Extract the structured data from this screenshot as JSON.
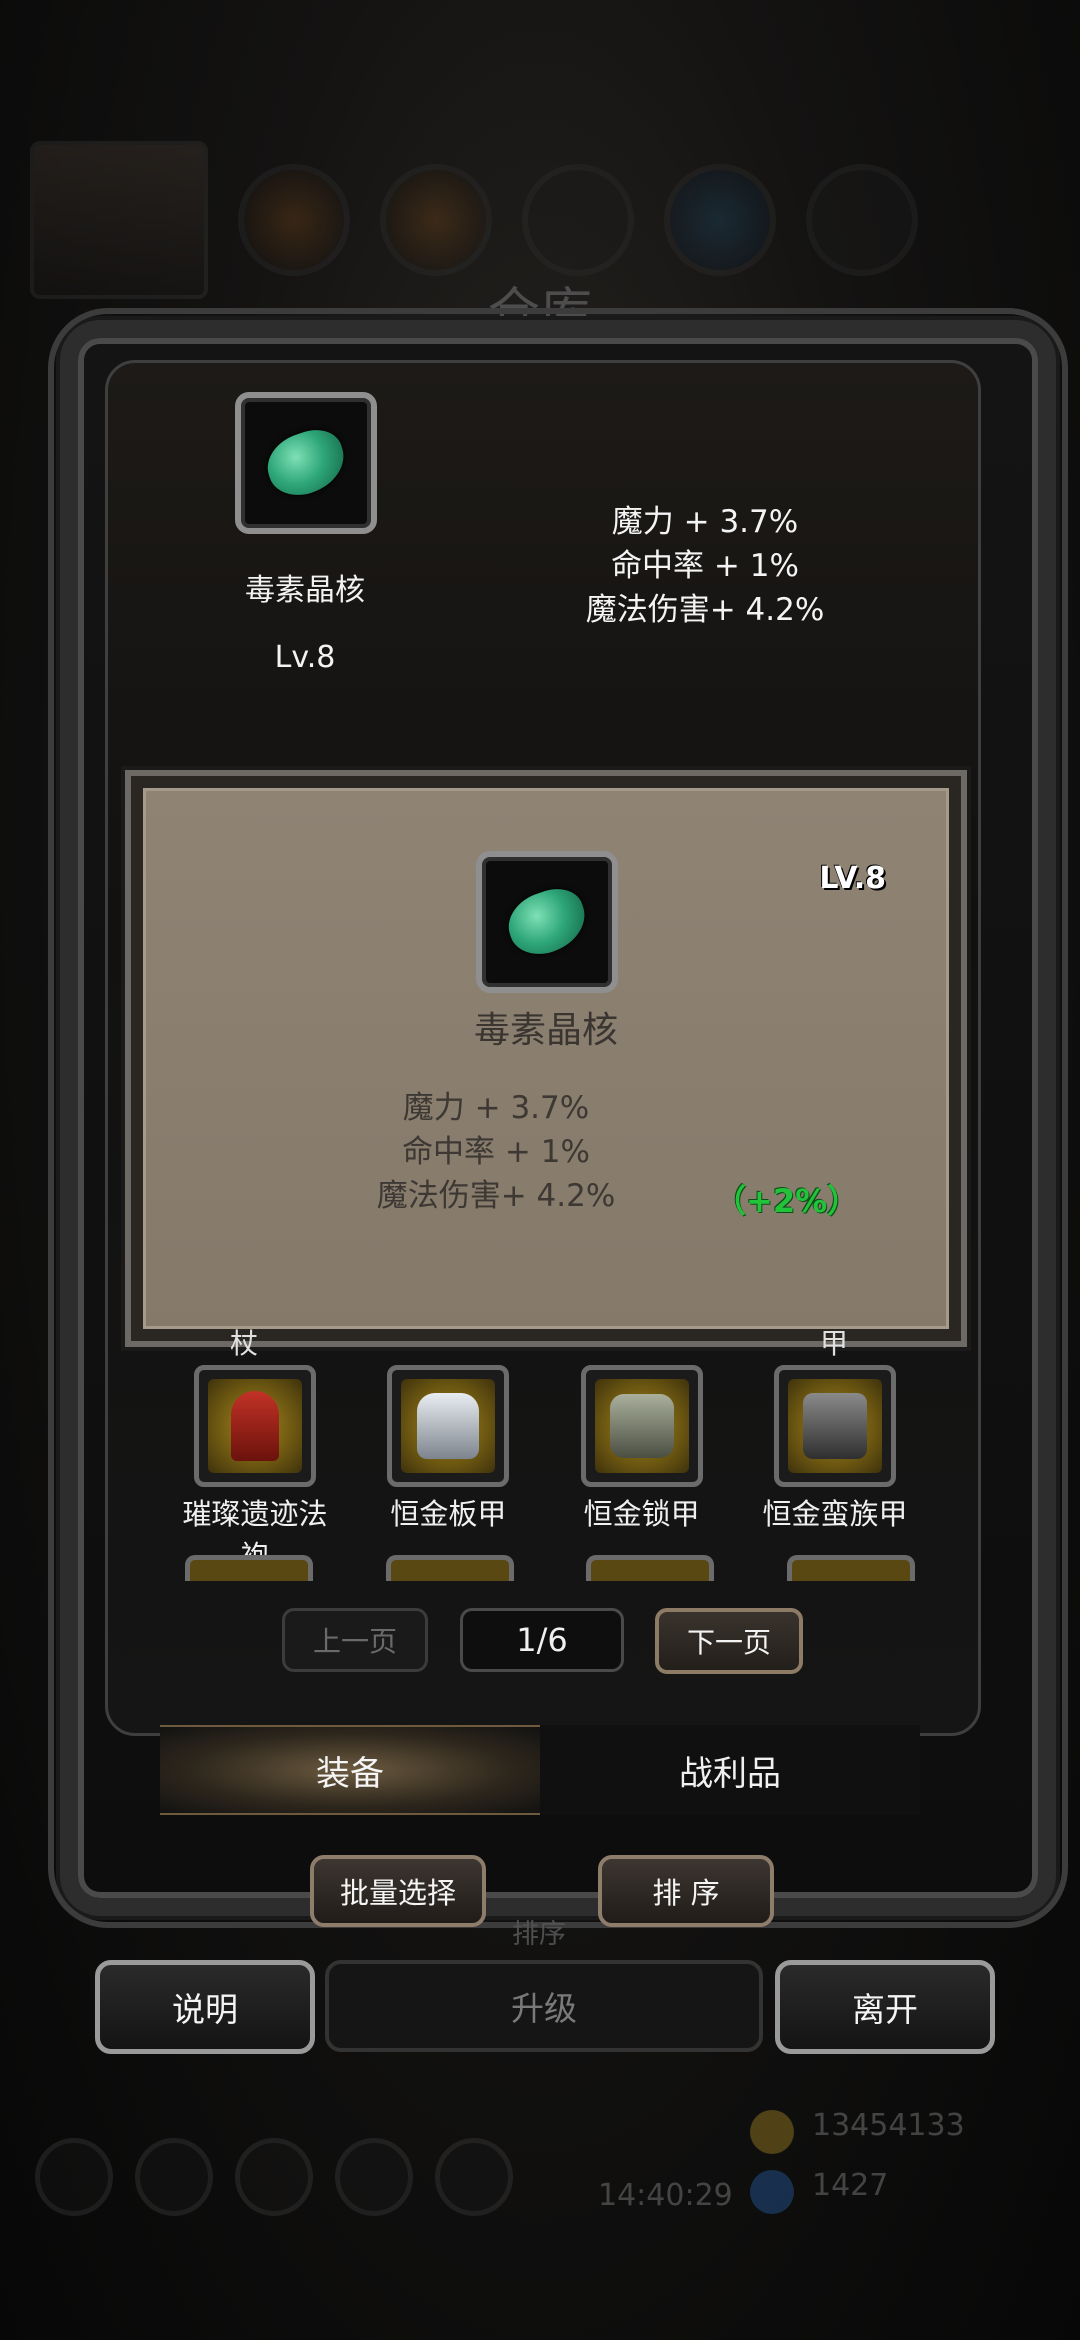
{
  "background": {
    "title": "仓库",
    "hud": {
      "gold": "13454133",
      "gems": "1427",
      "clock": "14:40:29"
    }
  },
  "item_header": {
    "name": "毒素晶核",
    "level": "Lv.8",
    "stats": [
      "魔力 + 3.7%",
      "命中率 + 1%",
      "魔法伤害+ 4.2%"
    ],
    "icon": "poison-crystal-gem-icon"
  },
  "tooltip": {
    "level": "LV.8",
    "name": "毒素晶核",
    "stats": [
      "魔力 + 3.7%",
      "命中率 + 1%",
      "魔法伤害+ 4.2%"
    ],
    "bonus": "（+2%）",
    "bonus_color": "#22c33a"
  },
  "cut_labels": [
    "杖",
    "甲"
  ],
  "items": [
    {
      "name": "璀璨遗迹法袍",
      "line1": "璀璨遗迹法",
      "line2": "袍",
      "icon": "robe-icon"
    },
    {
      "name": "恒金板甲",
      "line1": "恒金板甲",
      "line2": "",
      "icon": "plate-armor-icon"
    },
    {
      "name": "恒金锁甲",
      "line1": "恒金锁甲",
      "line2": "",
      "icon": "chain-armor-icon"
    },
    {
      "name": "恒金蛮族甲",
      "line1": "恒金蛮族甲",
      "line2": "",
      "icon": "barbarian-armor-icon"
    }
  ],
  "pager": {
    "prev": "上一页",
    "page": "1/6",
    "next": "下一页"
  },
  "tabs": [
    {
      "label": "装备",
      "active": true
    },
    {
      "label": "战利品",
      "active": false
    }
  ],
  "actions": {
    "batch": "批量选择",
    "sort": "排 序",
    "sort_ghost": "排序"
  },
  "bottom": {
    "help": "说明",
    "upgrade": "升级",
    "leave": "离开"
  }
}
